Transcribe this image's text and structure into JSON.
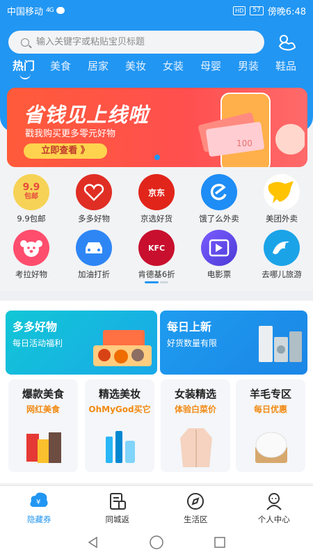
{
  "status": {
    "carrier": "中国移动",
    "signal": "4G",
    "hd": "HD",
    "battery": "57",
    "time": "傍晚6:48"
  },
  "search": {
    "placeholder": "输入关键字或粘贴宝贝标题"
  },
  "header": {
    "service_icon": "customer-service-icon"
  },
  "tabs": [
    {
      "label": "热门",
      "active": true
    },
    {
      "label": "美食"
    },
    {
      "label": "居家"
    },
    {
      "label": "美妆"
    },
    {
      "label": "女装"
    },
    {
      "label": "母婴"
    },
    {
      "label": "男装"
    },
    {
      "label": "鞋品"
    }
  ],
  "banner": {
    "title": "省钱见上线啦",
    "subtitle": "戳我购买更多零元好物",
    "button": "立即查看 》",
    "badge": "100"
  },
  "grid": [
    {
      "label": "9.9包邮",
      "icon": "9.9",
      "icon_sub": "包邮",
      "color": "#f3c33a"
    },
    {
      "label": "多多好物",
      "icon": "pdd-icon",
      "color": "#e02e24"
    },
    {
      "label": "京选好货",
      "icon": "京东",
      "color": "#e1251b"
    },
    {
      "label": "饿了么外卖",
      "icon": "eleme-icon",
      "color": "#1e8df5"
    },
    {
      "label": "美团外卖",
      "icon": "meituan-kangaroo-icon",
      "color": "#ffc300"
    },
    {
      "label": "考拉好物",
      "icon": "koala-icon",
      "color": "#ff4d6d"
    },
    {
      "label": "加油打折",
      "icon": "car-icon",
      "color": "#2e86f5"
    },
    {
      "label": "肯德基6折",
      "icon": "KFC",
      "color": "#c8102e"
    },
    {
      "label": "电影票",
      "icon": "film-icon",
      "color": "#6a4df2"
    },
    {
      "label": "去哪儿旅游",
      "icon": "qunar-dolphin-icon",
      "color": "#1ba3e8"
    }
  ],
  "promos": [
    {
      "title": "多多好物",
      "subtitle": "每日活动福利"
    },
    {
      "title": "每日上新",
      "subtitle": "好货数量有限"
    }
  ],
  "cards": [
    {
      "title": "爆款美食",
      "subtitle": "网红美食"
    },
    {
      "title": "精选美妆",
      "subtitle": "OhMyGod买它"
    },
    {
      "title": "女装精选",
      "subtitle": "体验白菜价"
    },
    {
      "title": "羊毛专区",
      "subtitle": "每日优惠"
    }
  ],
  "bottom_nav": [
    {
      "label": "隐藏券",
      "icon": "coupon-icon",
      "active": true
    },
    {
      "label": "同城返",
      "icon": "receipt-icon"
    },
    {
      "label": "生活区",
      "icon": "compass-icon"
    },
    {
      "label": "个人中心",
      "icon": "person-icon"
    }
  ],
  "colors": {
    "primary": "#2196f3",
    "banner": "#ff5050",
    "accent_orange": "#f28a12"
  }
}
